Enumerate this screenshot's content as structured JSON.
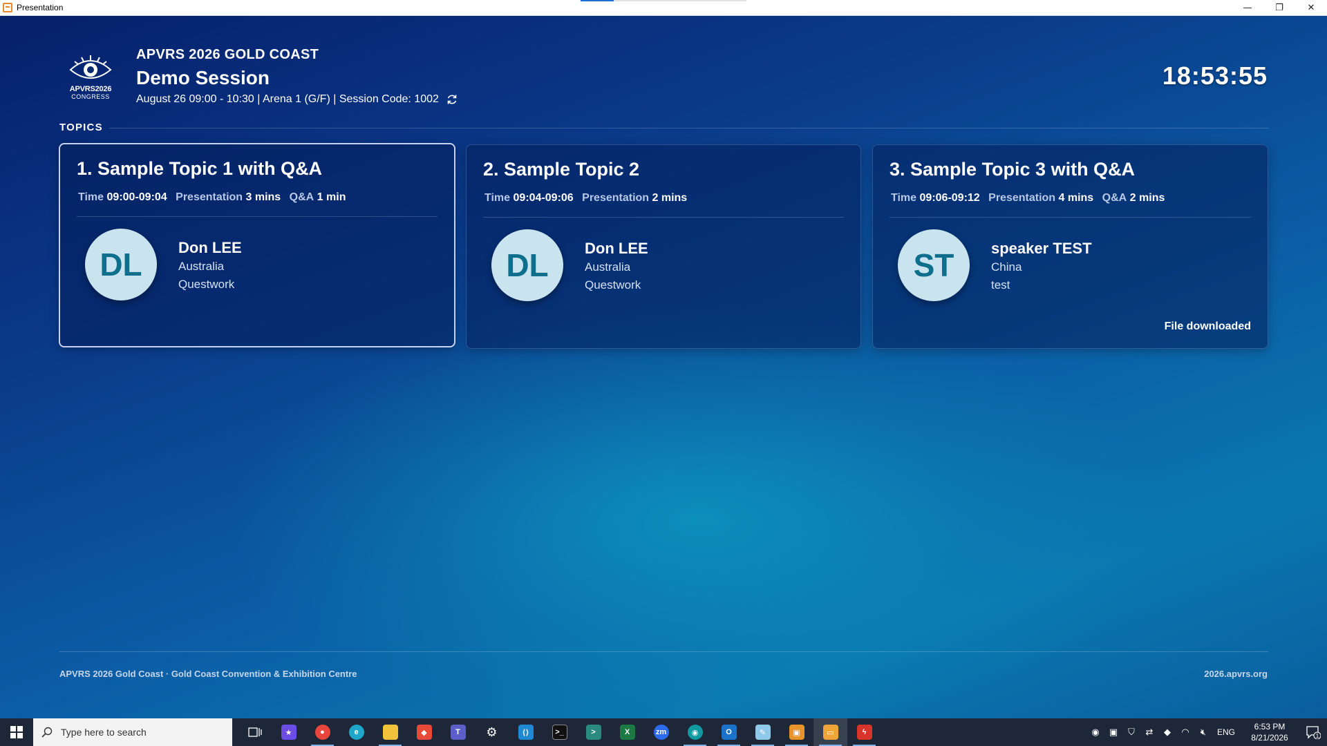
{
  "window": {
    "title": "Presentation",
    "controls": {
      "minimize": "—",
      "restore": "❐",
      "close": "✕"
    }
  },
  "header": {
    "logo_line1": "APVRS2026",
    "logo_line2": "CONGRESS",
    "eyebrow": "APVRS 2026 GOLD COAST",
    "session_title": "Demo Session",
    "session_details": "August 26 09:00 - 10:30 | Arena 1 (G/F) | Session Code: 1002",
    "clock": "18:53:55"
  },
  "topics": {
    "label": "TOPICS",
    "cards": [
      {
        "title": "1. Sample Topic 1 with Q&A",
        "time_label": "Time",
        "time": "09:00-09:04",
        "presentation_label": "Presentation",
        "presentation": "3 mins",
        "qa_label": "Q&A",
        "qa": "1 min",
        "initials": "DL",
        "speaker": "Don LEE",
        "country": "Australia",
        "organization": "Questwork",
        "status": ""
      },
      {
        "title": "2. Sample Topic 2",
        "time_label": "Time",
        "time": "09:04-09:06",
        "presentation_label": "Presentation",
        "presentation": "2 mins",
        "qa_label": "",
        "qa": "",
        "initials": "DL",
        "speaker": "Don LEE",
        "country": "Australia",
        "organization": "Questwork",
        "status": ""
      },
      {
        "title": "3. Sample Topic 3 with Q&A",
        "time_label": "Time",
        "time": "09:06-09:12",
        "presentation_label": "Presentation",
        "presentation": "4 mins",
        "qa_label": "Q&A",
        "qa": "2 mins",
        "initials": "ST",
        "speaker": "speaker TEST",
        "country": "China",
        "organization": "test",
        "status": "File downloaded"
      }
    ]
  },
  "footer": {
    "left": "APVRS 2026 Gold Coast · Gold Coast Convention & Exhibition Centre",
    "right": "2026.apvrs.org"
  },
  "taskbar": {
    "search_placeholder": "Type here to search",
    "language": "ENG",
    "time": "6:53 PM",
    "date": "8/21/2026",
    "notification_count": "1"
  },
  "colors": {
    "accent": "#0e6f8c",
    "avatar_bg": "#c9e3ef",
    "taskbar": "#1d2737"
  }
}
